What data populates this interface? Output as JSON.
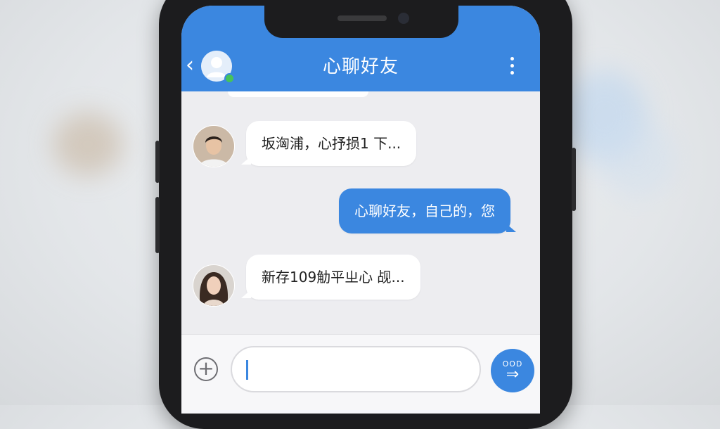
{
  "header": {
    "title": "心聊好友",
    "back_icon": "chevron-left-icon",
    "menu_icon": "more-vertical-icon"
  },
  "messages": [
    {
      "direction": "incoming",
      "text": "坂洶浦，心抒损1 下...",
      "avatar": "male-avatar"
    },
    {
      "direction": "outgoing",
      "text": "心聊好友，自己的，您"
    },
    {
      "direction": "incoming",
      "text": "新存109觔平ㄓ⼼ 觇...",
      "avatar": "female-avatar"
    }
  ],
  "composer": {
    "input_value": "",
    "send_label": "OOD",
    "send_glyph": "⇒",
    "plus_icon": "plus-circle-icon"
  },
  "colors": {
    "accent": "#3b87e0",
    "background": "#ededf0",
    "online": "#46c35a"
  }
}
